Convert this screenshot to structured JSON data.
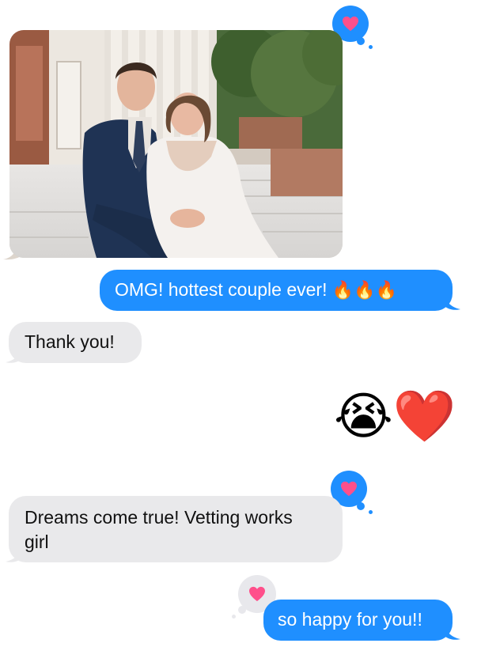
{
  "messages": [
    {
      "type": "photo",
      "direction": "received",
      "description": "couple-portrait-photo",
      "reaction": "heart-icon"
    },
    {
      "type": "text",
      "direction": "sent",
      "text": "OMG! hottest couple ever! 🔥🔥🔥"
    },
    {
      "type": "text",
      "direction": "received",
      "text": "Thank you!"
    },
    {
      "type": "emoji",
      "direction": "sent",
      "emojis": [
        "😭",
        "❤️"
      ]
    },
    {
      "type": "text",
      "direction": "received",
      "text": "Dreams come true! Vetting works girl",
      "reaction": "heart-icon"
    },
    {
      "type": "text",
      "direction": "sent",
      "text": "so happy for you!!",
      "reaction": "heart-icon"
    }
  ],
  "texts": {
    "msg2_main": "OMG! hottest couple ever!",
    "msg2_emoji": "🔥🔥🔥",
    "msg3": "Thank you!",
    "msg5_line1": "Dreams come true! Vetting works",
    "msg5_line2": "girl",
    "msg6": "so happy for you!!",
    "emoji_crying": "😭",
    "emoji_heart": "❤️"
  },
  "colors": {
    "sent_bubble": "#1f8fff",
    "received_bubble": "#e9e9eb",
    "reaction_heart": "#ff4f8b"
  }
}
